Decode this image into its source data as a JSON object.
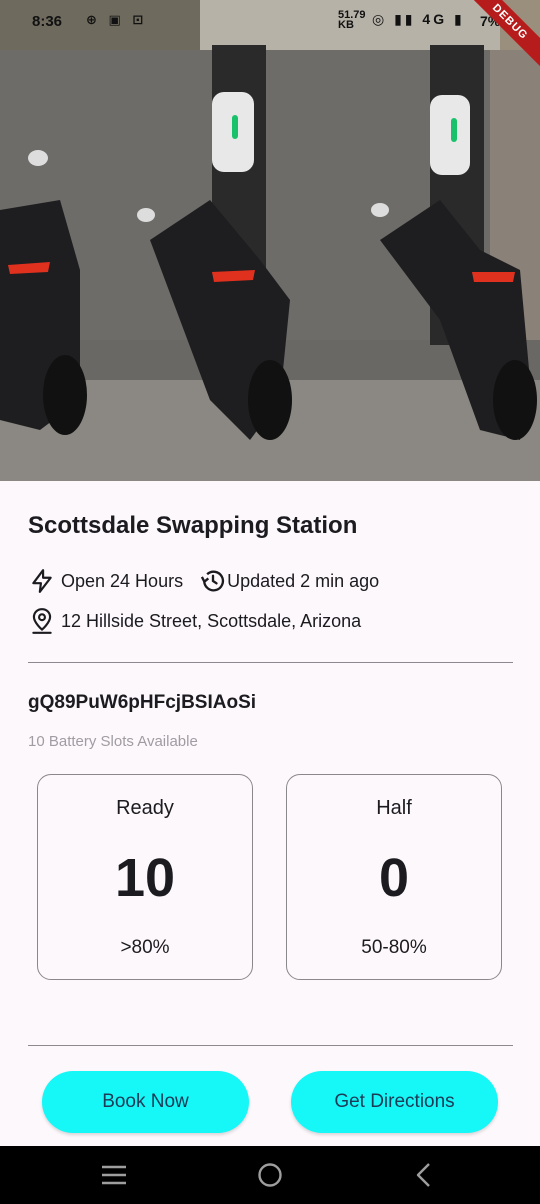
{
  "status_bar": {
    "time": "8:36",
    "left_icons": "⊕ ▣ ⊡",
    "network_speed": "51.79",
    "network_unit": "KB",
    "right_icons": "◎ ▮▮ 4G ▮",
    "battery": "7%"
  },
  "debug_banner": "DEBUG",
  "station": {
    "name": "Scottsdale Swapping Station",
    "hours": "Open 24 Hours",
    "updated": "Updated 2 min ago",
    "address": "12 Hillside Street, Scottsdale, Arizona",
    "id": "gQ89PuW6pHFcjBSIAoSi",
    "slots_available": "10 Battery Slots Available"
  },
  "battery_cards": [
    {
      "label": "Ready",
      "count": "10",
      "range": ">80%"
    },
    {
      "label": "Half",
      "count": "0",
      "range": "50-80%"
    }
  ],
  "buttons": {
    "book": "Book Now",
    "directions": "Get Directions"
  },
  "icons": {
    "hours": "bolt-icon",
    "updated": "history-icon",
    "address": "location-pin-icon"
  },
  "colors": {
    "button_bg": "#16f7f7",
    "button_text": "#1c3b57",
    "background": "#fcf8fc",
    "nav_bar": "#000000"
  }
}
